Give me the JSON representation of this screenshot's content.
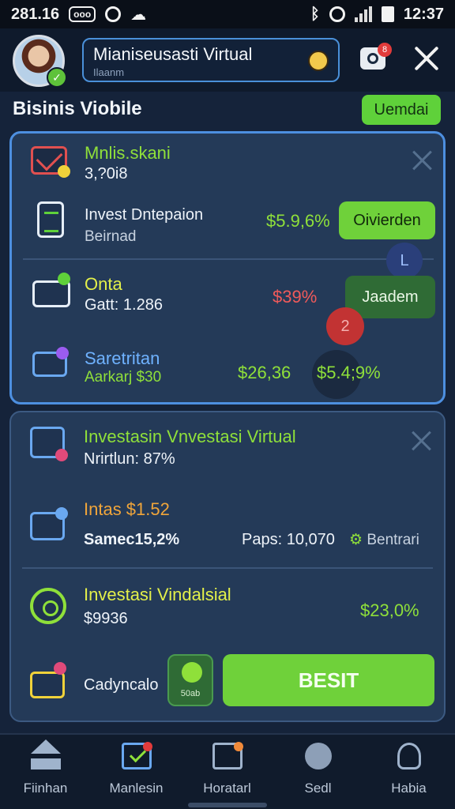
{
  "status_bar": {
    "time_left": "281.16",
    "box_label": "ooo",
    "time_right": "12:37"
  },
  "header": {
    "title": "Mianiseusasti Virtual",
    "subtitle": "Ilaanm",
    "camera_badge": "8"
  },
  "section": {
    "title": "Bisinis Viobile",
    "action_label": "Uemdai"
  },
  "card1": {
    "rows": [
      {
        "title": "Mnlis.skani",
        "subtitle": "3,?0i8"
      },
      {
        "title": "Invest Dntepaion",
        "subtitle": "Beirnad",
        "value": "$5.9,6%",
        "button": "Oivierden"
      },
      {
        "title": "Onta",
        "subtitle": "Gatt:",
        "number": "1.286",
        "value": "$39%",
        "button": "Jaadem",
        "float_l": "L",
        "float_2": "2"
      },
      {
        "title": "Saretritan",
        "subtitle": "Aarkarj $30",
        "value": "$26,36",
        "value2": "$5.4;9%"
      }
    ]
  },
  "card2": {
    "rows": [
      {
        "title": "Investasin Vnvestasi Virtual",
        "subtitle": "Nrirtlun: 87%"
      },
      {
        "title": "Intas $1.52",
        "subtitle": "Samec15,2%",
        "extra": "Paps: 10,070",
        "link": "Bentrari"
      },
      {
        "title": "Investasi Vindalsial",
        "subtitle": "$9936",
        "value": "$23,0%"
      },
      {
        "title": "Cadyncalo",
        "tag": "50ab",
        "button": "BESIT"
      }
    ]
  },
  "nav": [
    {
      "label": "Fiinhan"
    },
    {
      "label": "Manlesin"
    },
    {
      "label": "Horatarl"
    },
    {
      "label": "Sedl"
    },
    {
      "label": "Habia"
    }
  ],
  "colors": {
    "accent": "#6fd13a",
    "background": "#15233a",
    "card": "#243a58"
  }
}
